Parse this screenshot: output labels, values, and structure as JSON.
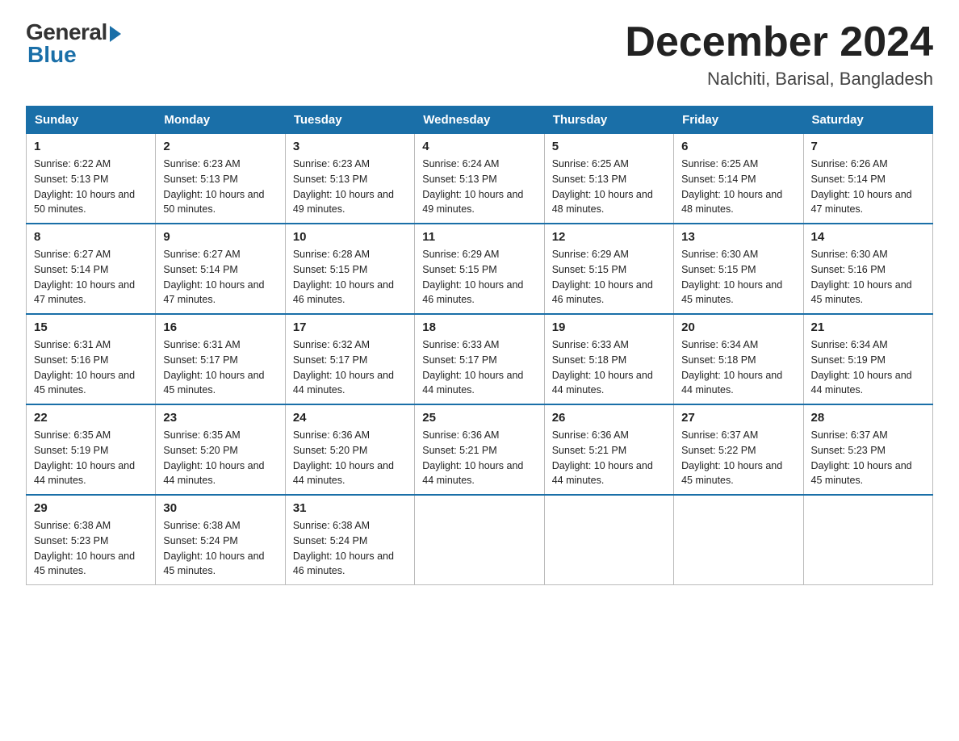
{
  "header": {
    "logo_general": "General",
    "logo_blue": "Blue",
    "month_title": "December 2024",
    "location": "Nalchiti, Barisal, Bangladesh"
  },
  "days_of_week": [
    "Sunday",
    "Monday",
    "Tuesday",
    "Wednesday",
    "Thursday",
    "Friday",
    "Saturday"
  ],
  "weeks": [
    [
      {
        "day": "1",
        "sunrise": "6:22 AM",
        "sunset": "5:13 PM",
        "daylight": "10 hours and 50 minutes."
      },
      {
        "day": "2",
        "sunrise": "6:23 AM",
        "sunset": "5:13 PM",
        "daylight": "10 hours and 50 minutes."
      },
      {
        "day": "3",
        "sunrise": "6:23 AM",
        "sunset": "5:13 PM",
        "daylight": "10 hours and 49 minutes."
      },
      {
        "day": "4",
        "sunrise": "6:24 AM",
        "sunset": "5:13 PM",
        "daylight": "10 hours and 49 minutes."
      },
      {
        "day": "5",
        "sunrise": "6:25 AM",
        "sunset": "5:13 PM",
        "daylight": "10 hours and 48 minutes."
      },
      {
        "day": "6",
        "sunrise": "6:25 AM",
        "sunset": "5:14 PM",
        "daylight": "10 hours and 48 minutes."
      },
      {
        "day": "7",
        "sunrise": "6:26 AM",
        "sunset": "5:14 PM",
        "daylight": "10 hours and 47 minutes."
      }
    ],
    [
      {
        "day": "8",
        "sunrise": "6:27 AM",
        "sunset": "5:14 PM",
        "daylight": "10 hours and 47 minutes."
      },
      {
        "day": "9",
        "sunrise": "6:27 AM",
        "sunset": "5:14 PM",
        "daylight": "10 hours and 47 minutes."
      },
      {
        "day": "10",
        "sunrise": "6:28 AM",
        "sunset": "5:15 PM",
        "daylight": "10 hours and 46 minutes."
      },
      {
        "day": "11",
        "sunrise": "6:29 AM",
        "sunset": "5:15 PM",
        "daylight": "10 hours and 46 minutes."
      },
      {
        "day": "12",
        "sunrise": "6:29 AM",
        "sunset": "5:15 PM",
        "daylight": "10 hours and 46 minutes."
      },
      {
        "day": "13",
        "sunrise": "6:30 AM",
        "sunset": "5:15 PM",
        "daylight": "10 hours and 45 minutes."
      },
      {
        "day": "14",
        "sunrise": "6:30 AM",
        "sunset": "5:16 PM",
        "daylight": "10 hours and 45 minutes."
      }
    ],
    [
      {
        "day": "15",
        "sunrise": "6:31 AM",
        "sunset": "5:16 PM",
        "daylight": "10 hours and 45 minutes."
      },
      {
        "day": "16",
        "sunrise": "6:31 AM",
        "sunset": "5:17 PM",
        "daylight": "10 hours and 45 minutes."
      },
      {
        "day": "17",
        "sunrise": "6:32 AM",
        "sunset": "5:17 PM",
        "daylight": "10 hours and 44 minutes."
      },
      {
        "day": "18",
        "sunrise": "6:33 AM",
        "sunset": "5:17 PM",
        "daylight": "10 hours and 44 minutes."
      },
      {
        "day": "19",
        "sunrise": "6:33 AM",
        "sunset": "5:18 PM",
        "daylight": "10 hours and 44 minutes."
      },
      {
        "day": "20",
        "sunrise": "6:34 AM",
        "sunset": "5:18 PM",
        "daylight": "10 hours and 44 minutes."
      },
      {
        "day": "21",
        "sunrise": "6:34 AM",
        "sunset": "5:19 PM",
        "daylight": "10 hours and 44 minutes."
      }
    ],
    [
      {
        "day": "22",
        "sunrise": "6:35 AM",
        "sunset": "5:19 PM",
        "daylight": "10 hours and 44 minutes."
      },
      {
        "day": "23",
        "sunrise": "6:35 AM",
        "sunset": "5:20 PM",
        "daylight": "10 hours and 44 minutes."
      },
      {
        "day": "24",
        "sunrise": "6:36 AM",
        "sunset": "5:20 PM",
        "daylight": "10 hours and 44 minutes."
      },
      {
        "day": "25",
        "sunrise": "6:36 AM",
        "sunset": "5:21 PM",
        "daylight": "10 hours and 44 minutes."
      },
      {
        "day": "26",
        "sunrise": "6:36 AM",
        "sunset": "5:21 PM",
        "daylight": "10 hours and 44 minutes."
      },
      {
        "day": "27",
        "sunrise": "6:37 AM",
        "sunset": "5:22 PM",
        "daylight": "10 hours and 45 minutes."
      },
      {
        "day": "28",
        "sunrise": "6:37 AM",
        "sunset": "5:23 PM",
        "daylight": "10 hours and 45 minutes."
      }
    ],
    [
      {
        "day": "29",
        "sunrise": "6:38 AM",
        "sunset": "5:23 PM",
        "daylight": "10 hours and 45 minutes."
      },
      {
        "day": "30",
        "sunrise": "6:38 AM",
        "sunset": "5:24 PM",
        "daylight": "10 hours and 45 minutes."
      },
      {
        "day": "31",
        "sunrise": "6:38 AM",
        "sunset": "5:24 PM",
        "daylight": "10 hours and 46 minutes."
      },
      null,
      null,
      null,
      null
    ]
  ],
  "labels": {
    "sunrise": "Sunrise:",
    "sunset": "Sunset:",
    "daylight": "Daylight:"
  }
}
